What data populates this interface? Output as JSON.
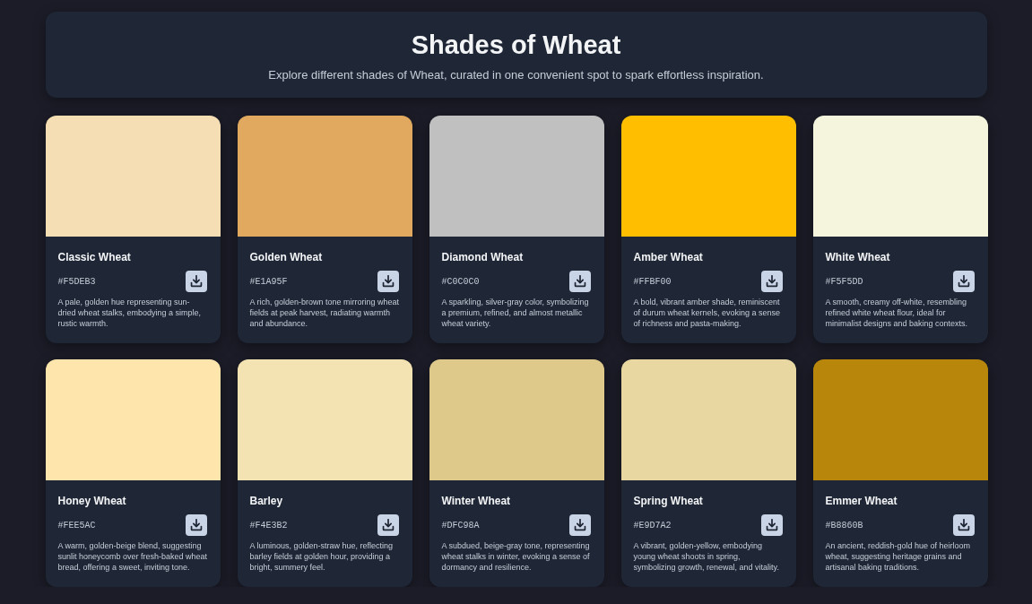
{
  "header": {
    "title": "Shades of Wheat",
    "subtitle": "Explore different shades of Wheat, curated in one convenient spot to spark effortless inspiration."
  },
  "shades": [
    {
      "name": "Classic Wheat",
      "hex": "#F5DEB3",
      "color": "#f5deb3",
      "description": "A pale, golden hue representing sun-dried wheat stalks, embodying a simple, rustic warmth."
    },
    {
      "name": "Golden Wheat",
      "hex": "#E1A95F",
      "color": "#e1a95f",
      "description": "A rich, golden-brown tone mirroring wheat fields at peak harvest, radiating warmth and abundance."
    },
    {
      "name": "Diamond Wheat",
      "hex": "#C0C0C0",
      "color": "#c0c0c0",
      "description": "A sparkling, silver-gray color, symbolizing a premium, refined, and almost metallic wheat variety."
    },
    {
      "name": "Amber Wheat",
      "hex": "#FFBF00",
      "color": "#ffbf00",
      "description": "A bold, vibrant amber shade, reminiscent of durum wheat kernels, evoking a sense of richness and pasta-making."
    },
    {
      "name": "White Wheat",
      "hex": "#F5F5DD",
      "color": "#f5f5dd",
      "description": "A smooth, creamy off-white, resembling refined white wheat flour, ideal for minimalist designs and baking contexts."
    },
    {
      "name": "Honey Wheat",
      "hex": "#FEE5AC",
      "color": "#fee5ac",
      "description": "A warm, golden-beige blend, suggesting sunlit honeycomb over fresh-baked wheat bread, offering a sweet, inviting tone."
    },
    {
      "name": "Barley",
      "hex": "#F4E3B2",
      "color": "#f4e3b2",
      "description": "A luminous, golden-straw hue, reflecting barley fields at golden hour, providing a bright, summery feel."
    },
    {
      "name": "Winter Wheat",
      "hex": "#DFC98A",
      "color": "#dfc98a",
      "description": "A subdued, beige-gray tone, representing wheat stalks in winter, evoking a sense of dormancy and resilience."
    },
    {
      "name": "Spring Wheat",
      "hex": "#E9D7A2",
      "color": "#e9d7a2",
      "description": "A vibrant, golden-yellow, embodying young wheat shoots in spring, symbolizing growth, renewal, and vitality."
    },
    {
      "name": "Emmer Wheat",
      "hex": "#B8860B",
      "color": "#b8860b",
      "description": "An ancient, reddish-gold hue of heirloom wheat, suggesting heritage grains and artisanal baking traditions."
    }
  ]
}
